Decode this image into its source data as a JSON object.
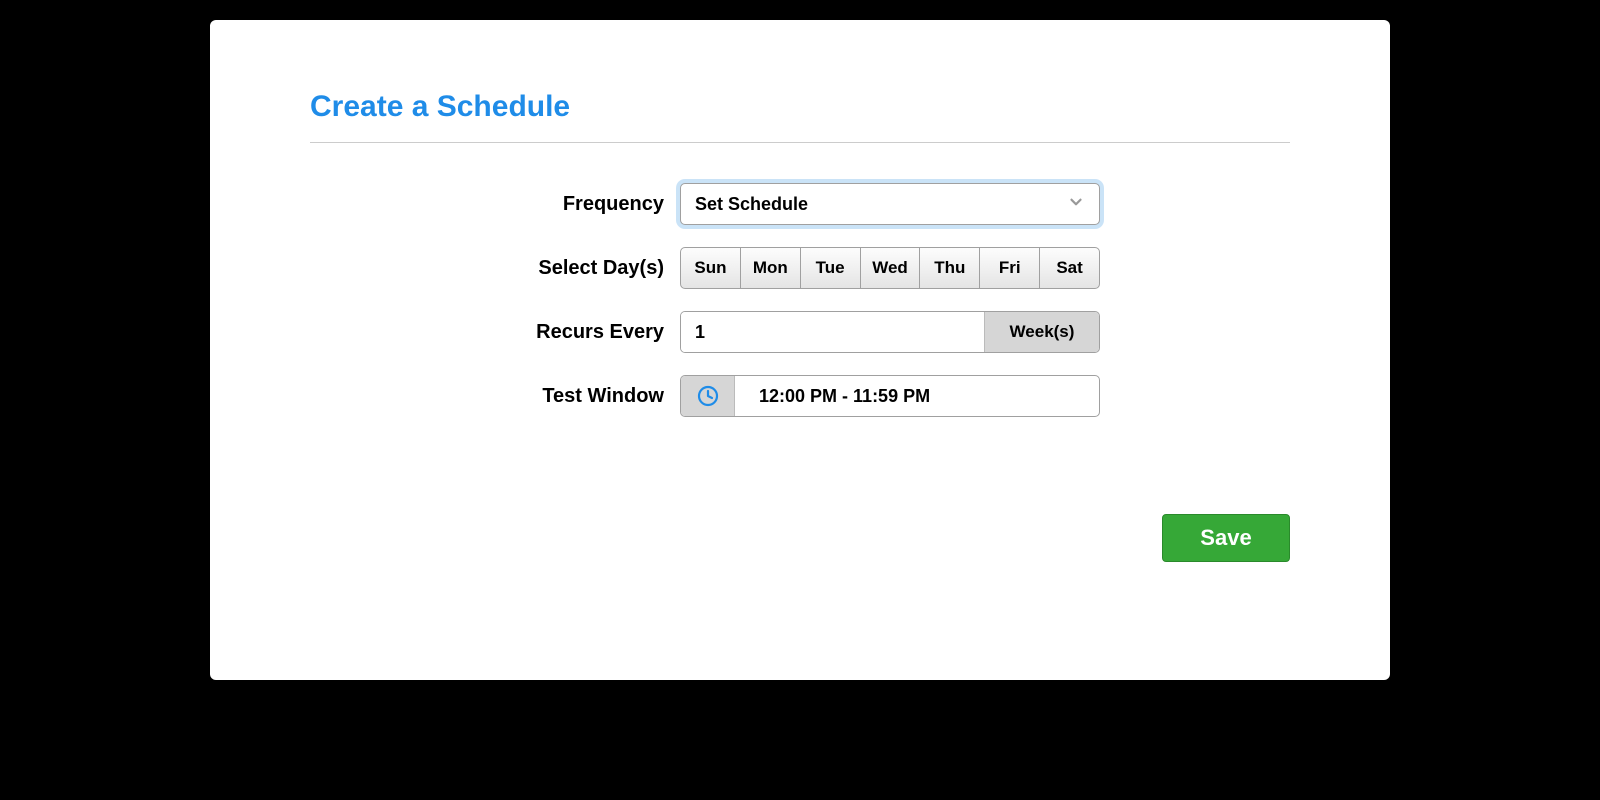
{
  "title": "Create a Schedule",
  "labels": {
    "frequency": "Frequency",
    "select_days": "Select Day(s)",
    "recurs_every": "Recurs Every",
    "test_window": "Test Window"
  },
  "frequency": {
    "selected": "Set Schedule"
  },
  "days": [
    "Sun",
    "Mon",
    "Tue",
    "Wed",
    "Thu",
    "Fri",
    "Sat"
  ],
  "recurs": {
    "value": "1",
    "unit": "Week(s)"
  },
  "test_window": {
    "value": "12:00 PM - 11:59 PM"
  },
  "save_label": "Save"
}
